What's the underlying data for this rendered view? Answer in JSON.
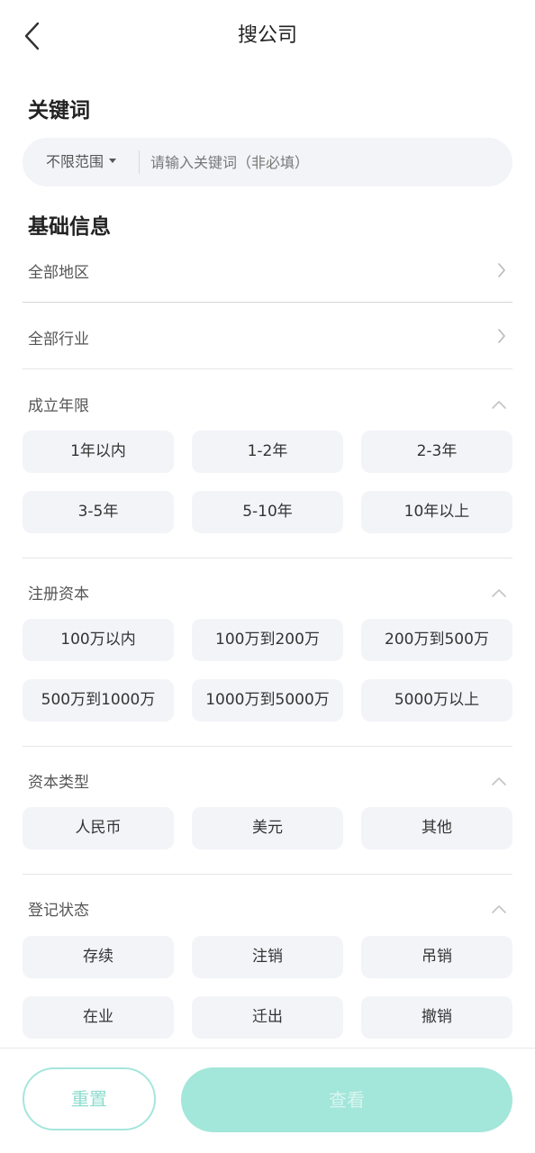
{
  "header": {
    "title": "搜公司"
  },
  "keyword": {
    "title": "关键词",
    "scope_label": "不限范围",
    "placeholder": "请输入关键词（非必填）"
  },
  "basic": {
    "title": "基础信息",
    "region_label": "全部地区",
    "industry_label": "全部行业"
  },
  "groups": {
    "years": {
      "label": "成立年限",
      "options": [
        "1年以内",
        "1-2年",
        "2-3年",
        "3-5年",
        "5-10年",
        "10年以上"
      ]
    },
    "capital": {
      "label": "注册资本",
      "options": [
        "100万以内",
        "100万到200万",
        "200万到500万",
        "500万到1000万",
        "1000万到5000万",
        "5000万以上"
      ]
    },
    "capital_type": {
      "label": "资本类型",
      "options": [
        "人民币",
        "美元",
        "其他"
      ]
    },
    "status": {
      "label": "登记状态",
      "options": [
        "存续",
        "注销",
        "吊销",
        "在业",
        "迁出",
        "撤销"
      ]
    }
  },
  "footer": {
    "reset_label": "重置",
    "view_label": "查看"
  },
  "colors": {
    "accent": "#a3e6da",
    "accent_text": "#8fdccf",
    "chip_bg": "#f3f4f8"
  }
}
